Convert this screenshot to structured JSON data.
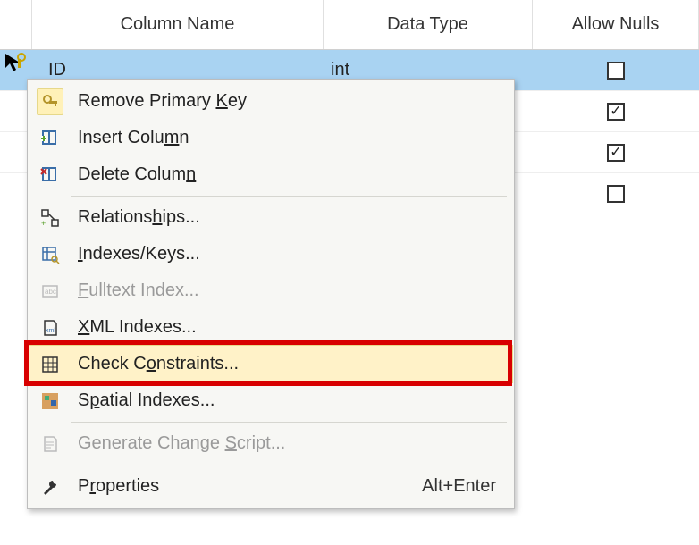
{
  "headers": {
    "name": "Column Name",
    "type": "Data Type",
    "nulls": "Allow Nulls"
  },
  "rows": [
    {
      "name": "ID",
      "type": "int",
      "nulls": false,
      "selected": true
    },
    {
      "name": "",
      "type": "",
      "nulls": true,
      "selected": false
    },
    {
      "name": "",
      "type": "",
      "nulls": true,
      "selected": false
    },
    {
      "name": "",
      "type": "",
      "nulls": false,
      "selected": false
    }
  ],
  "context_menu": {
    "items": [
      {
        "id": "remove-pk",
        "label_before": "Remove Primary ",
        "mnemonic": "K",
        "label_after": "ey",
        "enabled": true,
        "icon": "key-icon"
      },
      {
        "id": "insert-col",
        "label_before": "Insert Colu",
        "mnemonic": "m",
        "label_after": "n",
        "enabled": true,
        "icon": "insert-column-icon"
      },
      {
        "id": "delete-col",
        "label_before": "Delete Colum",
        "mnemonic": "n",
        "label_after": "",
        "enabled": true,
        "icon": "delete-column-icon"
      },
      {
        "sep": true
      },
      {
        "id": "relationships",
        "label_before": "Relations",
        "mnemonic": "h",
        "label_after": "ips...",
        "enabled": true,
        "icon": "relationships-icon"
      },
      {
        "id": "indexes-keys",
        "label_before": "",
        "mnemonic": "I",
        "label_after": "ndexes/Keys...",
        "enabled": true,
        "icon": "indexes-keys-icon"
      },
      {
        "id": "fulltext",
        "label_before": "",
        "mnemonic": "F",
        "label_after": "ulltext Index...",
        "enabled": false,
        "icon": "fulltext-icon"
      },
      {
        "id": "xml-indexes",
        "label_before": "",
        "mnemonic": "X",
        "label_after": "ML Indexes...",
        "enabled": true,
        "icon": "xml-icon"
      },
      {
        "id": "check-constraints",
        "label_before": "Check C",
        "mnemonic": "o",
        "label_after": "nstraints...",
        "enabled": true,
        "icon": "grid-icon",
        "hovered": true,
        "highlighted": true
      },
      {
        "id": "spatial",
        "label_before": "S",
        "mnemonic": "p",
        "label_after": "atial Indexes...",
        "enabled": true,
        "icon": "spatial-icon"
      },
      {
        "sep": true
      },
      {
        "id": "gen-script",
        "label_before": "Generate Change ",
        "mnemonic": "S",
        "label_after": "cript...",
        "enabled": false,
        "icon": "script-icon"
      },
      {
        "sep": true
      },
      {
        "id": "properties",
        "label_before": "P",
        "mnemonic": "r",
        "label_after": "operties",
        "enabled": true,
        "icon": "wrench-icon",
        "shortcut": "Alt+Enter"
      }
    ]
  }
}
